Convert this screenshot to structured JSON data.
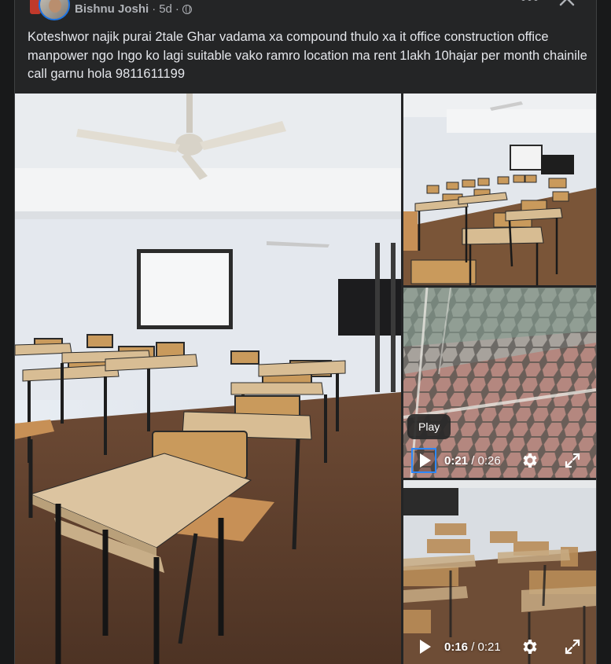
{
  "post": {
    "author": "Bishnu Joshi",
    "time": "5d",
    "separator": "·",
    "caption": "Koteshwor najik purai 2tale Ghar vadama xa compound thulo xa it office construction office manpower ngo Ingo ko lagi suitable vako ramro location ma rent 1lakh 10hajar per month chainile call garnu hola 9811611199"
  },
  "videos": [
    {
      "current": "0:21",
      "total": "0:26",
      "tooltip": "Play",
      "slash": "/"
    },
    {
      "current": "0:16",
      "total": "0:21",
      "slash": "/"
    }
  ],
  "icons": {
    "audience": "globe-icon",
    "more": "more-icon",
    "close": "close-icon",
    "play": "play-icon",
    "settings": "gear-icon",
    "fullscreen": "fullscreen-icon"
  },
  "colors": {
    "background": "#18191a",
    "card": "#242526",
    "text": "#e4e6eb",
    "secondary_text": "#b0b3b8",
    "focus": "#2d88ff"
  }
}
